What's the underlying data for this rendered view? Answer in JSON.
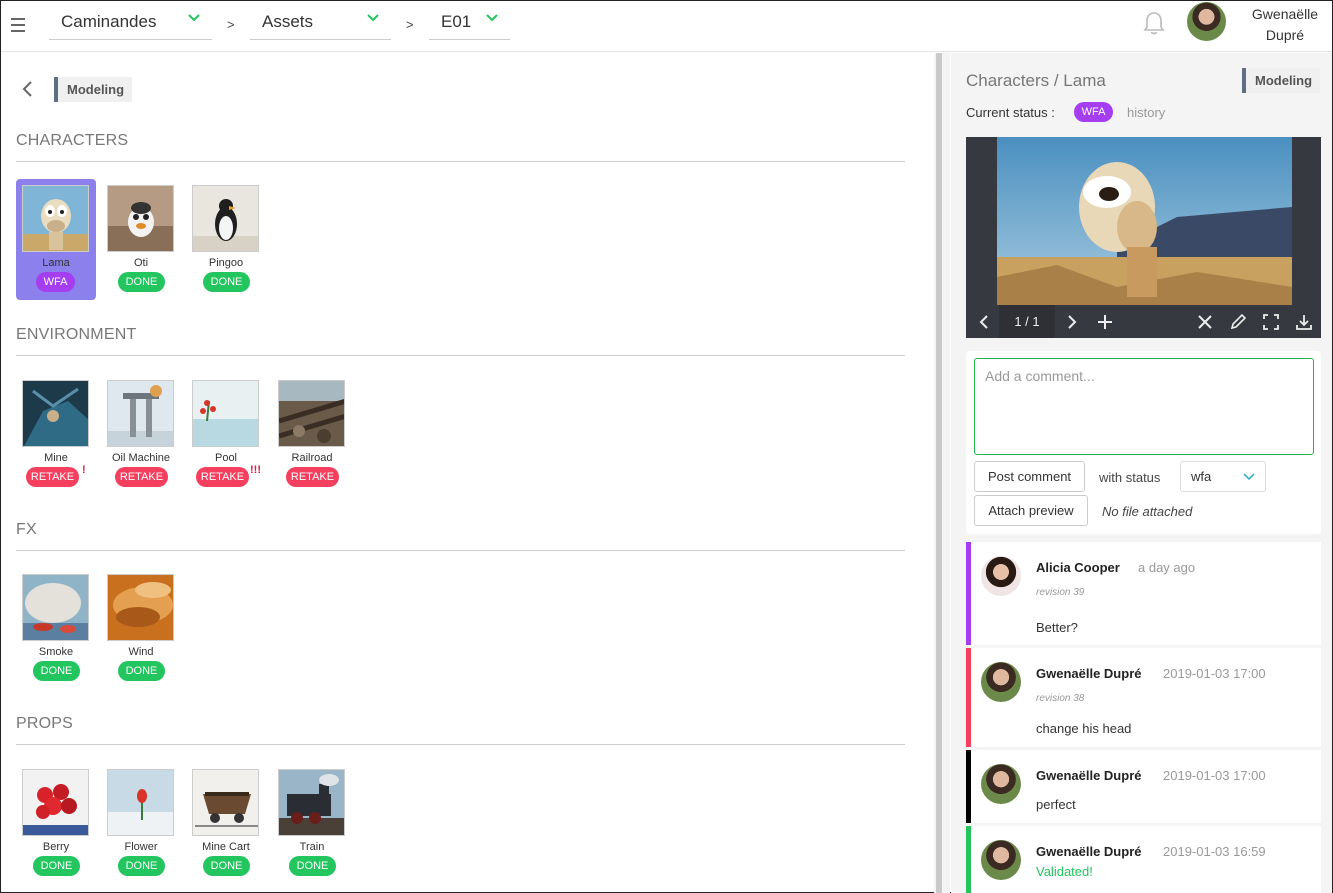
{
  "header": {
    "breadcrumbs": [
      {
        "label": "Caminandes"
      },
      {
        "label": "Assets"
      },
      {
        "label": "E01"
      }
    ],
    "separator": ">",
    "user": {
      "first_name": "Gwenaëlle",
      "last_name": "Dupré"
    }
  },
  "left": {
    "task_type": "Modeling",
    "sections": [
      {
        "title": "CHARACTERS"
      },
      {
        "title": "ENVIRONMENT"
      },
      {
        "title": "FX"
      },
      {
        "title": "PROPS"
      }
    ],
    "assets": {
      "characters": [
        {
          "name": "Lama",
          "status": "WFA"
        },
        {
          "name": "Oti",
          "status": "DONE"
        },
        {
          "name": "Pingoo",
          "status": "DONE"
        }
      ],
      "environment": [
        {
          "name": "Mine",
          "status": "RETAKE",
          "priority": "!"
        },
        {
          "name": "Oil Machine",
          "status": "RETAKE",
          "priority": ""
        },
        {
          "name": "Pool",
          "status": "RETAKE",
          "priority": "!!!"
        },
        {
          "name": "Railroad",
          "status": "RETAKE",
          "priority": ""
        }
      ],
      "fx": [
        {
          "name": "Smoke",
          "status": "DONE"
        },
        {
          "name": "Wind",
          "status": "DONE"
        }
      ],
      "props": [
        {
          "name": "Berry",
          "status": "DONE"
        },
        {
          "name": "Flower",
          "status": "DONE"
        },
        {
          "name": "Mine Cart",
          "status": "DONE"
        },
        {
          "name": "Train",
          "status": "DONE"
        }
      ]
    }
  },
  "right": {
    "entity_title": "Characters / Lama",
    "task_type": "Modeling",
    "current_status_label": "Current status :",
    "current_status": "WFA",
    "history_label": "history",
    "preview": {
      "page": "1 / 1"
    },
    "comment_form": {
      "placeholder": "Add a comment...",
      "post_label": "Post comment",
      "with_status_label": "with status",
      "status_value": "wfa",
      "attach_label": "Attach preview",
      "no_file_label": "No file attached"
    },
    "comments": [
      {
        "author": "Alicia Cooper",
        "date": "a day ago",
        "revision": "revision 39",
        "text": "Better?",
        "color": "#a43ef0"
      },
      {
        "author": "Gwenaëlle Dupré",
        "date": "2019-01-03 17:00",
        "revision": "revision 38",
        "text": "change his head",
        "color": "#f43f5e"
      },
      {
        "author": "Gwenaëlle Dupré",
        "date": "2019-01-03 17:00",
        "revision": "",
        "text": "perfect",
        "color": "#000000"
      },
      {
        "author": "Gwenaëlle Dupré",
        "date": "2019-01-03 16:59",
        "revision": "",
        "text": "Validated!",
        "color": "#22c55e"
      }
    ]
  },
  "colors": {
    "wfa": "#a43ef0",
    "done": "#22c55e",
    "retake": "#f43f5e",
    "selected": "#8b80ec",
    "accent_green": "#24b04e"
  }
}
